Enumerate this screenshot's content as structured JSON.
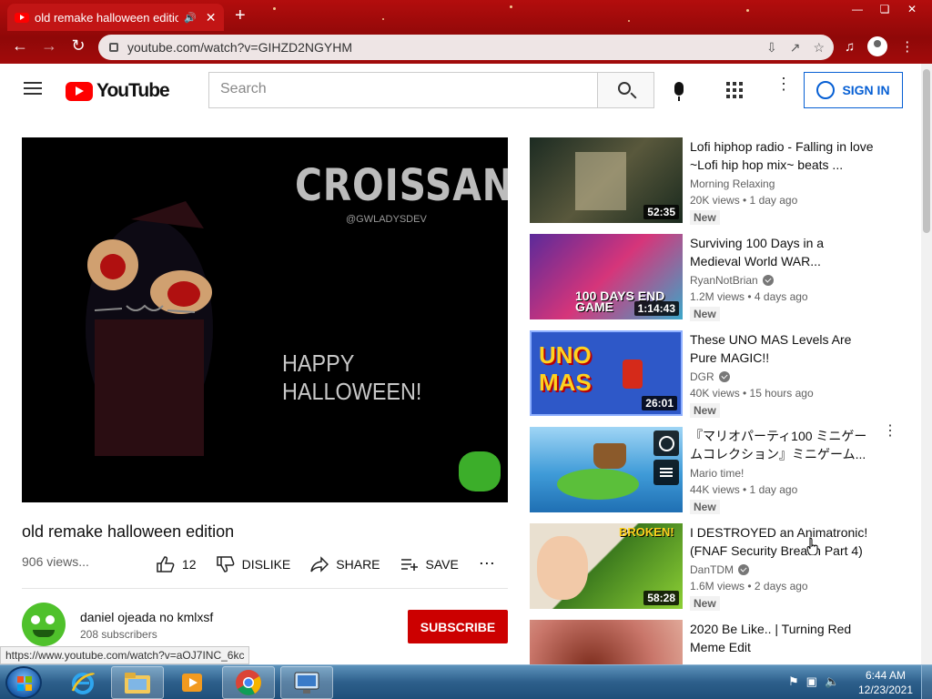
{
  "browser": {
    "tab_title": "old remake halloween editio",
    "address": "youtube.com/watch?v=GIHZD2NGYHM",
    "new_tab": "+"
  },
  "youtube": {
    "logo_text": "YouTube",
    "search_placeholder": "Search",
    "sign_in": "SIGN IN"
  },
  "video": {
    "title": "old remake halloween edition",
    "views": "906 views...",
    "overlay_title": "CROISSANT",
    "overlay_handle": "@GWLADYSDEV",
    "overlay_text": "HAPPY HALLOWEEN!",
    "likes": "12",
    "dislike": "DISLIKE",
    "share": "SHARE",
    "save": "SAVE"
  },
  "channel": {
    "name": "daniel ojeada no kmlxsf",
    "subscribers": "208 subscribers",
    "subscribe": "SUBSCRIBE"
  },
  "status_url": "https://www.youtube.com/watch?v=aOJ7INC_6kc",
  "recommendations": [
    {
      "title": "Lofi hiphop radio - Falling in love ~Lofi hip hop mix~ beats ...",
      "channel": "Morning Relaxing",
      "verified": false,
      "meta": "20K views • 1 day ago",
      "badge": "New",
      "duration": "52:35",
      "color": "#2f3a2a"
    },
    {
      "title": "Surviving 100 Days in a Medieval World WAR...",
      "channel": "RyanNotBrian",
      "verified": true,
      "meta": "1.2M views • 4 days ago",
      "badge": "New",
      "duration": "1:14:43",
      "color": "#c0245e",
      "thumb_text": "100 DAYS END GAME"
    },
    {
      "title": "These UNO MAS Levels Are Pure MAGIC!!",
      "channel": "DGR",
      "verified": true,
      "meta": "40K views • 15 hours ago",
      "badge": "New",
      "duration": "26:01",
      "color": "#3d6ad6",
      "thumb_text": "UNO MAS"
    },
    {
      "title": "『マリオパーティ100 ミニゲームコレクション』ミニゲーム...",
      "channel": "Mario time!",
      "verified": false,
      "meta": "44K views • 1 day ago",
      "badge": "New",
      "duration": "",
      "color": "#3f9bd8"
    },
    {
      "title": "I DESTROYED an Animatronic! (FNAF Security Breach Part 4)",
      "channel": "DanTDM",
      "verified": true,
      "meta": "1.6M views • 2 days ago",
      "badge": "New",
      "duration": "58:28",
      "color": "#5b8a2a",
      "thumb_text": "BROKEN!"
    },
    {
      "title": "2020 Be Like.. | Turning Red Meme Edit",
      "channel": "",
      "verified": false,
      "meta": "",
      "badge": "",
      "duration": "",
      "color": "#c9766a"
    }
  ],
  "taskbar": {
    "time": "6:44 AM",
    "date": "12/23/2021"
  }
}
